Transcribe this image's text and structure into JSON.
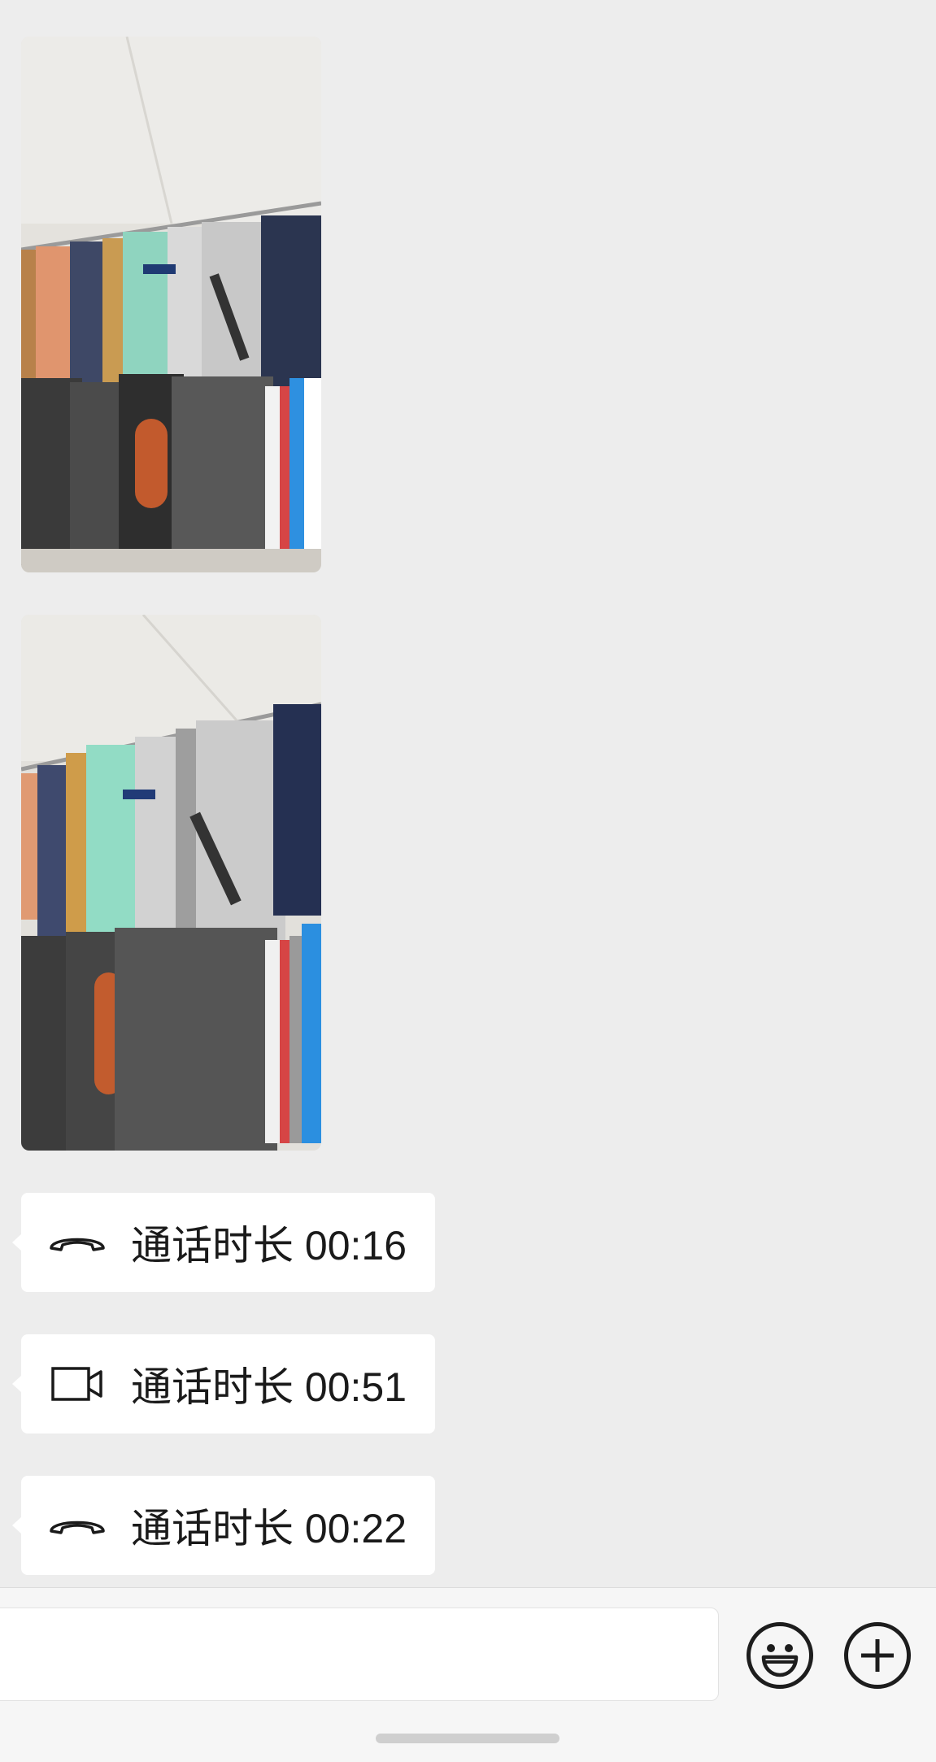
{
  "messages": [
    {
      "type": "image",
      "icon": "image-photo"
    },
    {
      "type": "image",
      "icon": "image-photo"
    },
    {
      "type": "call",
      "icon": "phone-call-icon",
      "text": "通话时长 00:16"
    },
    {
      "type": "call",
      "icon": "video-call-icon",
      "text": "通话时长 00:51"
    },
    {
      "type": "call",
      "icon": "phone-call-icon",
      "text": "通话时长 00:22"
    }
  ],
  "input": {
    "value": "",
    "placeholder": ""
  },
  "toolbar": {
    "emoji_icon": "emoji-icon",
    "more_icon": "plus-icon"
  },
  "colors": {
    "background": "#ededed",
    "bubble": "#ffffff",
    "bottom_bar": "#f6f6f6"
  }
}
